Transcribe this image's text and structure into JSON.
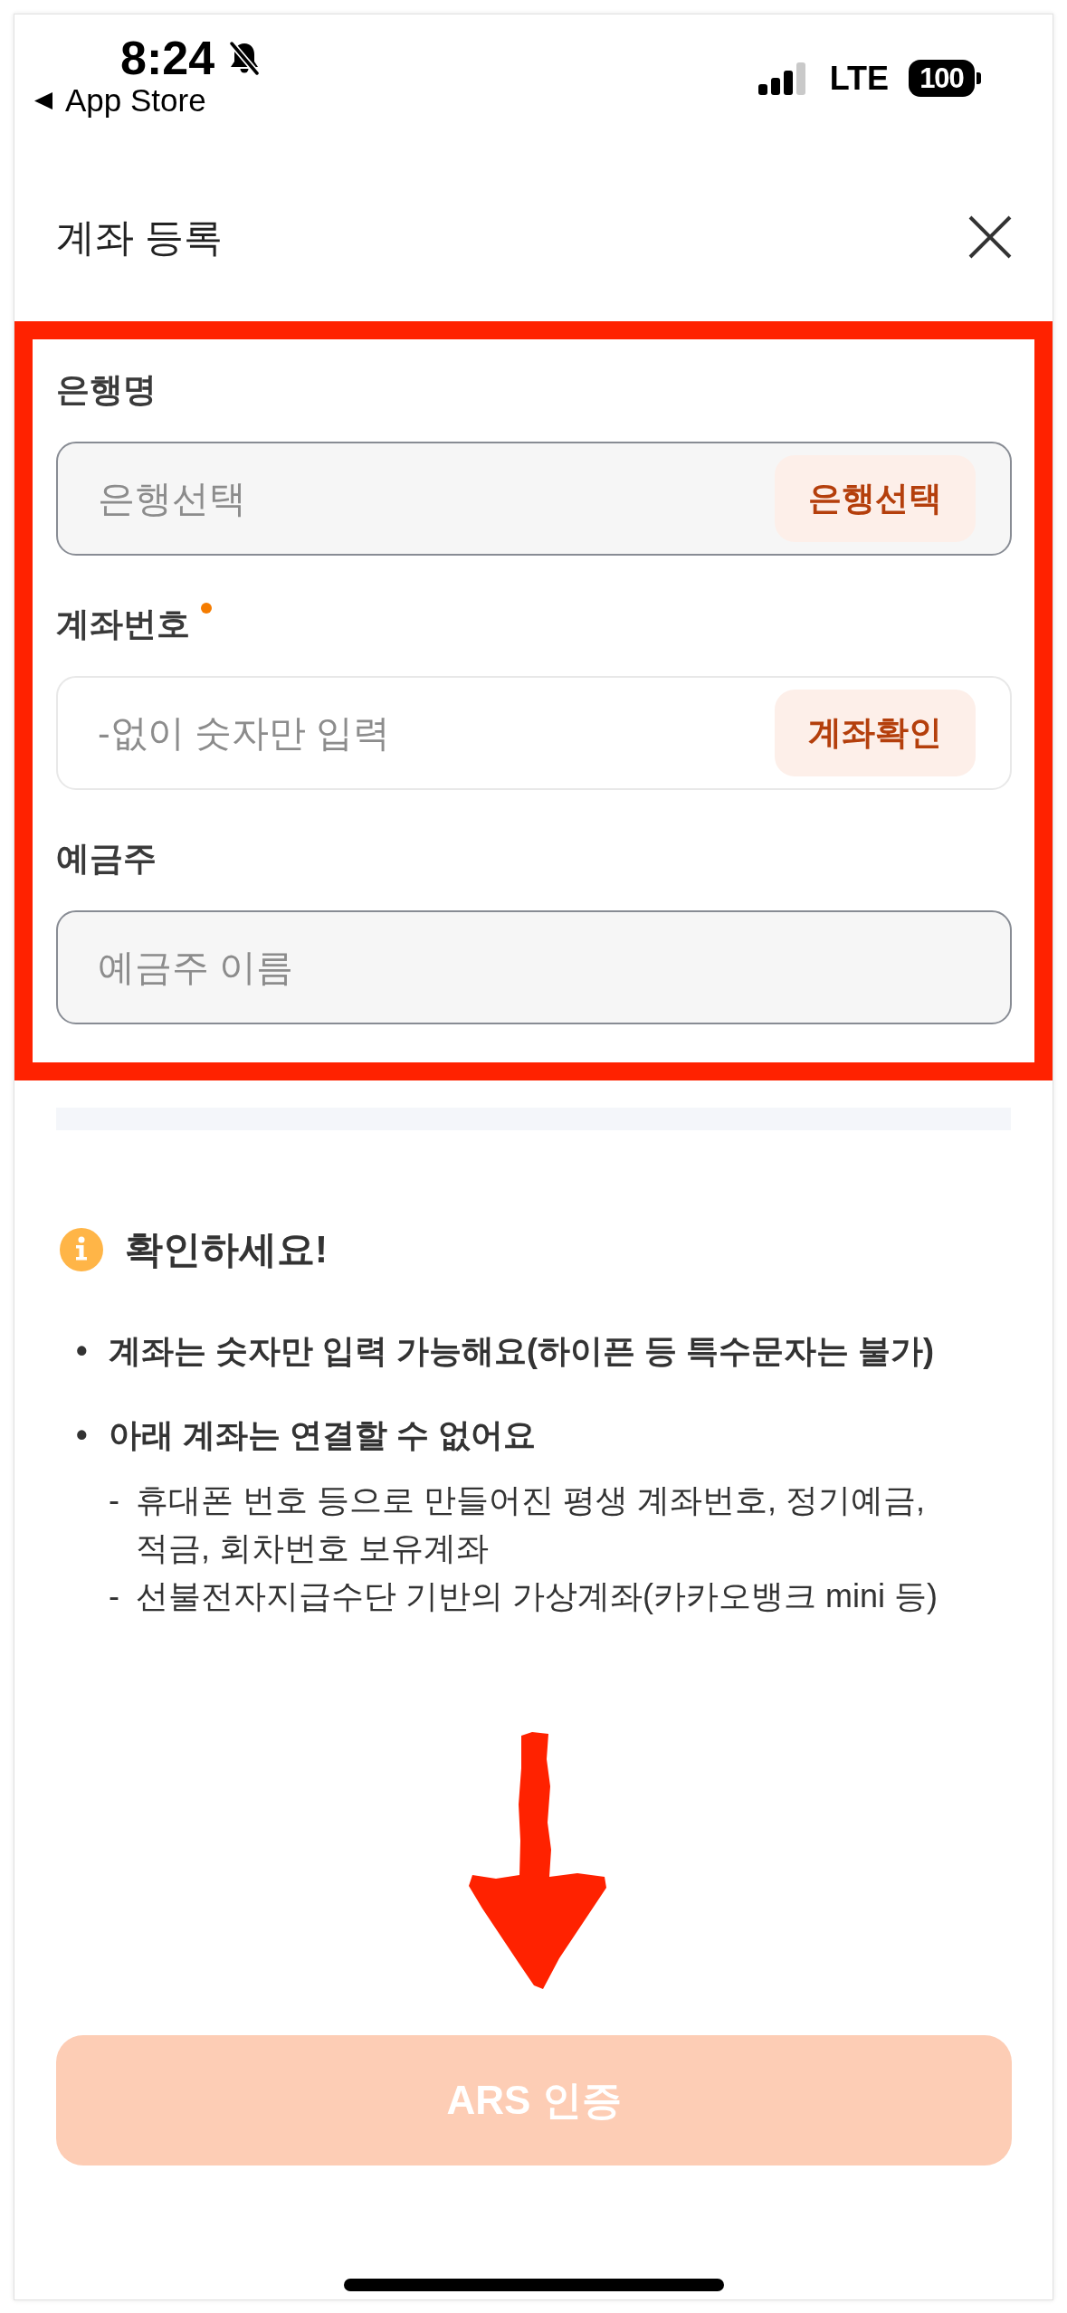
{
  "status_bar": {
    "time": "8:24",
    "back_label": "App Store",
    "network": "LTE",
    "battery": "100"
  },
  "header": {
    "title": "계좌 등록"
  },
  "form": {
    "fields": [
      {
        "label": "은행명",
        "required": false,
        "disabled": true,
        "placeholder": "은행선택",
        "action": "은행선택"
      },
      {
        "label": "계좌번호",
        "required": true,
        "disabled": false,
        "placeholder": "-없이 숫자만 입력",
        "action": "계좌확인"
      },
      {
        "label": "예금주",
        "required": false,
        "disabled": true,
        "placeholder": "예금주 이름"
      }
    ]
  },
  "notice": {
    "title": "확인하세요!",
    "items": [
      {
        "marker": "•",
        "text": "계좌는 숫자만 입력 가능해요(하이픈 등 특수문자는 불가)"
      },
      {
        "marker": "•",
        "text": "아래 계좌는 연결할 수 없어요",
        "children": [
          {
            "marker": "-",
            "text": "휴대폰 번호 등으로 만들어진 평생 계좌번호, 정기예금, 적금, 회차번호 보유계좌"
          },
          {
            "marker": "-",
            "text": "선불전자지급수단 기반의 가상계좌(카카오뱅크 mini 등)"
          }
        ]
      }
    ]
  },
  "submit_button": {
    "label": "ARS 인증",
    "disabled": true
  }
}
